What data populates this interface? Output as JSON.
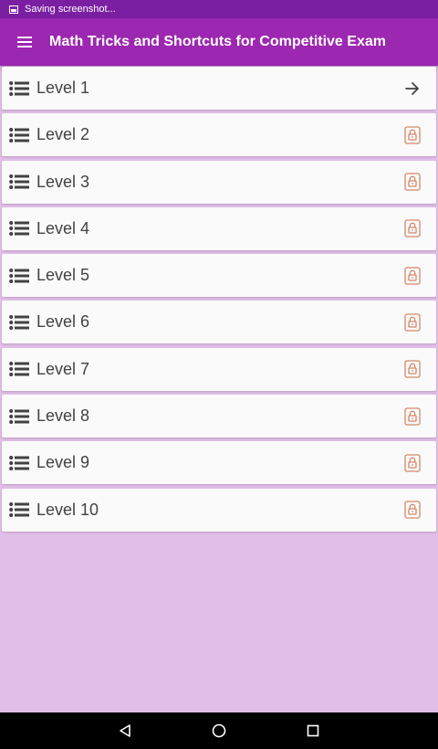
{
  "status_bar": {
    "notification_text": "Saving screenshot..."
  },
  "app_bar": {
    "title": "Math Tricks and Shortcuts for Competitive Exam"
  },
  "levels": [
    {
      "label": "Level 1",
      "state": "unlocked",
      "trailing_icon": "arrow-right-icon"
    },
    {
      "label": "Level 2",
      "state": "locked",
      "trailing_icon": "lock-icon"
    },
    {
      "label": "Level 3",
      "state": "locked",
      "trailing_icon": "lock-icon"
    },
    {
      "label": "Level 4",
      "state": "locked",
      "trailing_icon": "lock-icon"
    },
    {
      "label": "Level 5",
      "state": "locked",
      "trailing_icon": "lock-icon"
    },
    {
      "label": "Level 6",
      "state": "locked",
      "trailing_icon": "lock-icon"
    },
    {
      "label": "Level 7",
      "state": "locked",
      "trailing_icon": "lock-icon"
    },
    {
      "label": "Level 8",
      "state": "locked",
      "trailing_icon": "lock-icon"
    },
    {
      "label": "Level 9",
      "state": "locked",
      "trailing_icon": "lock-icon"
    },
    {
      "label": "Level 10",
      "state": "locked",
      "trailing_icon": "lock-icon"
    }
  ],
  "colors": {
    "status_bar": "#7b1fa2",
    "app_bar": "#9c27b0",
    "background": "#e1bee7",
    "lock_icon": "#d4876a",
    "row_icon": "#424242"
  },
  "nav_bar": {
    "buttons": [
      "back-icon",
      "home-icon",
      "recents-icon"
    ]
  }
}
